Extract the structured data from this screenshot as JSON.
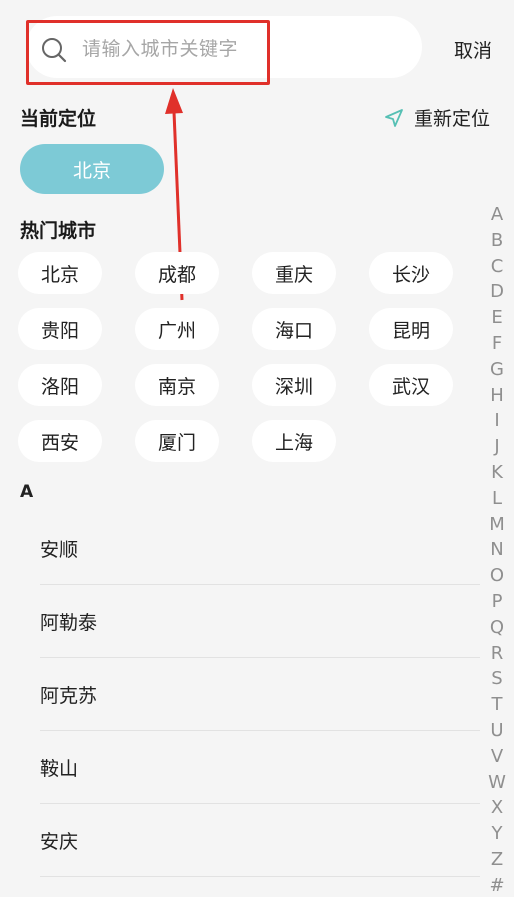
{
  "search": {
    "placeholder": "请输入城市关键字",
    "cancel_label": "取消"
  },
  "current_location": {
    "title": "当前定位",
    "relocate_label": "重新定位",
    "city": "北京"
  },
  "hot_cities": {
    "title": "热门城市",
    "items": [
      "北京",
      "成都",
      "重庆",
      "长沙",
      "贵阳",
      "广州",
      "海口",
      "昆明",
      "洛阳",
      "南京",
      "深圳",
      "武汉",
      "西安",
      "厦门",
      "上海"
    ]
  },
  "city_list": {
    "letter": "A",
    "items": [
      "安顺",
      "阿勒泰",
      "阿克苏",
      "鞍山",
      "安庆"
    ]
  },
  "index_letters": [
    "A",
    "B",
    "C",
    "D",
    "E",
    "F",
    "G",
    "H",
    "I",
    "J",
    "K",
    "L",
    "M",
    "N",
    "O",
    "P",
    "Q",
    "R",
    "S",
    "T",
    "U",
    "V",
    "W",
    "X",
    "Y",
    "Z",
    "#"
  ],
  "colors": {
    "accent": "#7dcad6",
    "highlight": "#e0302a",
    "background": "#f5f5f5"
  }
}
